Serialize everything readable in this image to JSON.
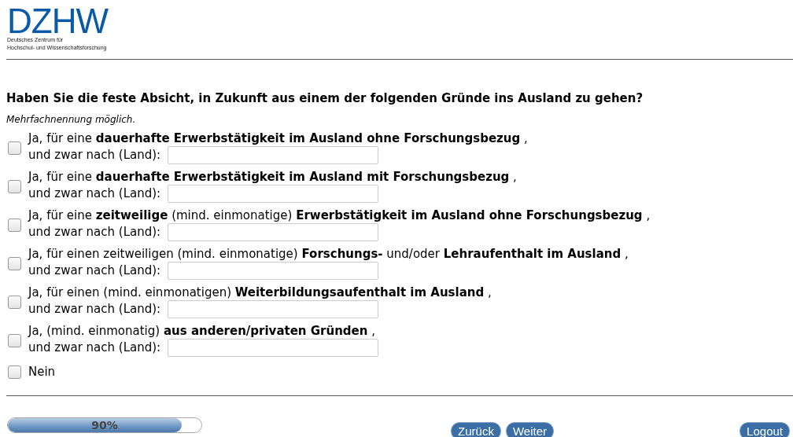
{
  "logo": {
    "wordmark": "DZHW",
    "subtitle_lines": [
      "Deutsches Zentrum für",
      "Hochschul- und Wissenschaftsforschung"
    ]
  },
  "question": {
    "title": "Haben Sie die feste Absicht, in Zukunft aus einem der folgenden Gründe ins Ausland zu gehen?",
    "hint": "Mehrfachnennung möglich.",
    "options": [
      {
        "kind": "with_country",
        "label": "Ja, für eine **dauerhafte Erwerbstätigkeit im Ausland ohne Forschungsbezug** ,",
        "sublabel": "und zwar nach (Land):",
        "checked": false
      },
      {
        "kind": "with_country",
        "label": "Ja, für eine **dauerhafte Erwerbstätigkeit im Ausland mit Forschungsbezug** ,",
        "sublabel": "und zwar nach (Land):",
        "checked": false
      },
      {
        "kind": "with_country",
        "label": "Ja, für eine **zeitweilige** (mind. einmonatige) **Erwerbstätigkeit im Ausland ohne Forschungsbezug** ,",
        "sublabel": "und zwar nach (Land):",
        "checked": false
      },
      {
        "kind": "with_country",
        "label": "Ja, für einen zeitweiligen (mind. einmonatige) **Forschungs-** und/oder **Lehraufenthalt im Ausland** ,",
        "sublabel": "und zwar nach (Land):",
        "checked": false
      },
      {
        "kind": "with_country",
        "label": "Ja, für einen (mind. einmonatigen) **Weiterbildungsaufenthalt im Ausland** ,",
        "sublabel": "und zwar nach (Land):",
        "checked": false
      },
      {
        "kind": "with_country",
        "label": "Ja, (mind. einmonatig) **aus anderen/privaten Gründen** ,",
        "sublabel": "und zwar nach (Land):",
        "checked": false
      },
      {
        "kind": "plain",
        "label": "Nein",
        "checked": false
      }
    ]
  },
  "footer": {
    "progress": {
      "level": 0.9,
      "reading": "90%"
    },
    "buttons": [
      "Zurück",
      "Weiter"
    ],
    "logout": "Logout"
  }
}
